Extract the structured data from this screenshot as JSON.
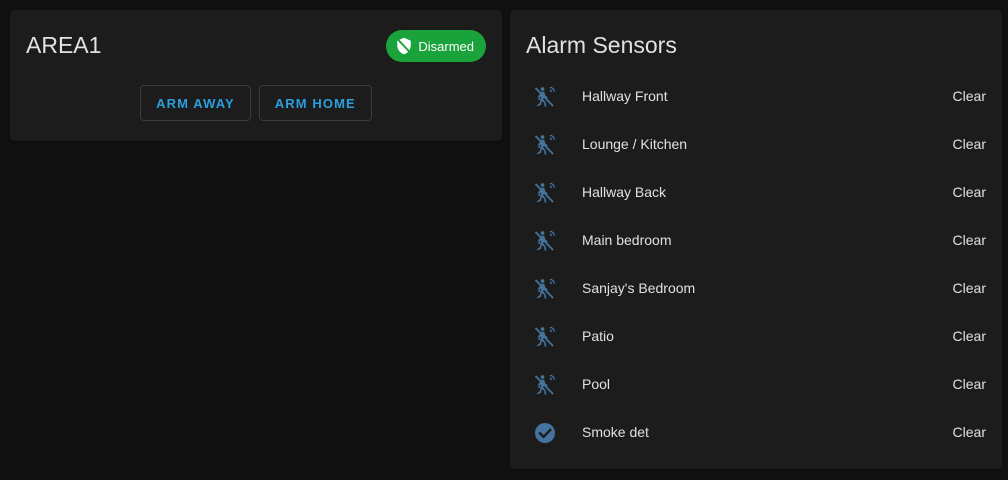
{
  "colors": {
    "page_background": "#111111",
    "card_background": "#1c1c1c",
    "text_primary": "#e1e1e1",
    "accent_blue": "#2a9fdc",
    "badge_green": "#1aa33a",
    "sensor_icon": "#44739e"
  },
  "alarm_panel": {
    "title": "AREA1",
    "state_badge": {
      "label": "Disarmed",
      "icon": "shield-off-icon"
    },
    "actions": [
      {
        "label": "ARM AWAY"
      },
      {
        "label": "ARM HOME"
      }
    ]
  },
  "sensors_card": {
    "title": "Alarm Sensors",
    "items": [
      {
        "name": "Hallway Front",
        "state": "Clear",
        "icon": "motion-sensor-off-icon"
      },
      {
        "name": "Lounge / Kitchen",
        "state": "Clear",
        "icon": "motion-sensor-off-icon"
      },
      {
        "name": "Hallway Back",
        "state": "Clear",
        "icon": "motion-sensor-off-icon"
      },
      {
        "name": "Main bedroom",
        "state": "Clear",
        "icon": "motion-sensor-off-icon"
      },
      {
        "name": "Sanjay's Bedroom",
        "state": "Clear",
        "icon": "motion-sensor-off-icon"
      },
      {
        "name": "Patio",
        "state": "Clear",
        "icon": "motion-sensor-off-icon"
      },
      {
        "name": "Pool",
        "state": "Clear",
        "icon": "motion-sensor-off-icon"
      },
      {
        "name": "Smoke det",
        "state": "Clear",
        "icon": "check-circle-icon"
      }
    ]
  }
}
